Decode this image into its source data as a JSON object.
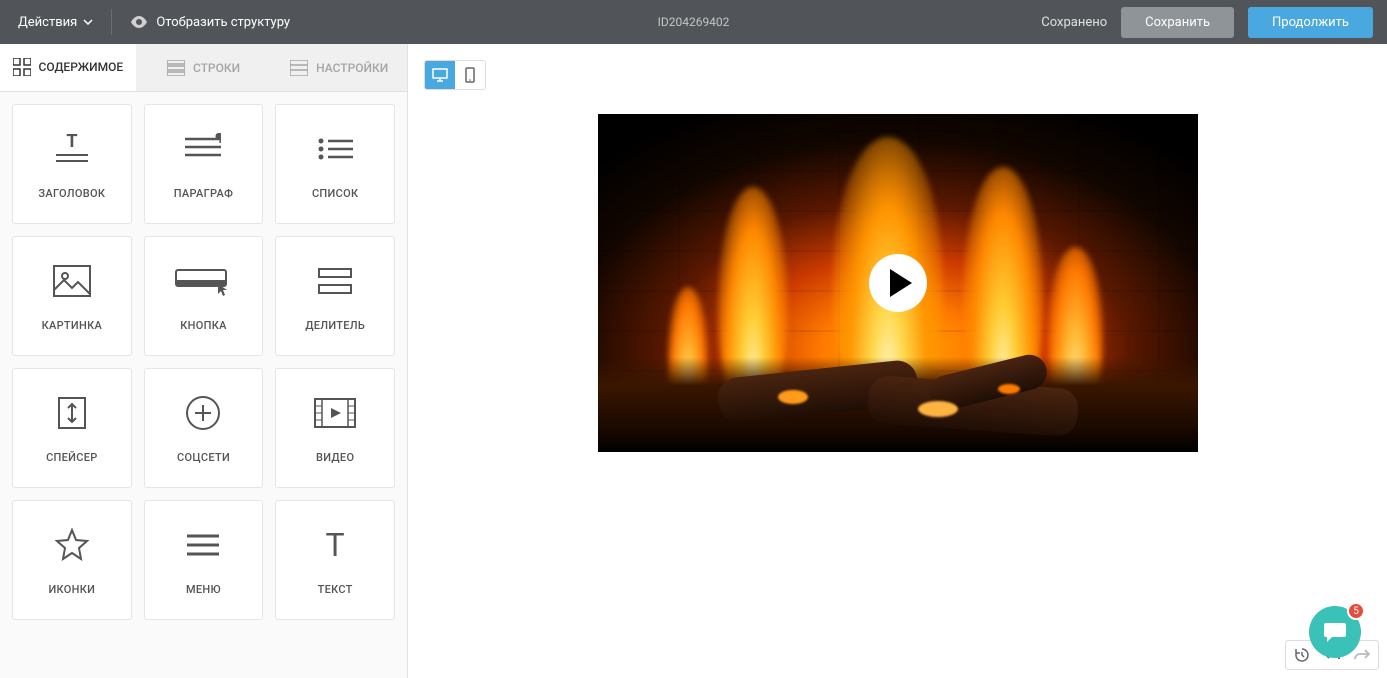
{
  "topbar": {
    "actions_label": "Действия",
    "show_structure": "Отобразить структуру",
    "doc_id": "ID204269402",
    "status": "Сохранено",
    "save_label": "Сохранить",
    "continue_label": "Продолжить"
  },
  "tabs": {
    "content": "СОДЕРЖИМОЕ",
    "rows": "СТРОКИ",
    "settings": "НАСТРОЙКИ"
  },
  "blocks": [
    {
      "id": "heading",
      "label": "ЗАГОЛОВОК"
    },
    {
      "id": "paragraph",
      "label": "ПАРАГРАФ"
    },
    {
      "id": "list",
      "label": "СПИСОК"
    },
    {
      "id": "image",
      "label": "КАРТИНКА"
    },
    {
      "id": "button",
      "label": "КНОПКА"
    },
    {
      "id": "divider",
      "label": "ДЕЛИТЕЛЬ"
    },
    {
      "id": "spacer",
      "label": "СПЕЙСЕР"
    },
    {
      "id": "social",
      "label": "СОЦСЕТИ"
    },
    {
      "id": "video",
      "label": "ВИДЕО"
    },
    {
      "id": "icons",
      "label": "ИКОНКИ"
    },
    {
      "id": "menu",
      "label": "МЕНЮ"
    },
    {
      "id": "text",
      "label": "ТЕКСТ"
    }
  ],
  "chat": {
    "badge": "5"
  }
}
